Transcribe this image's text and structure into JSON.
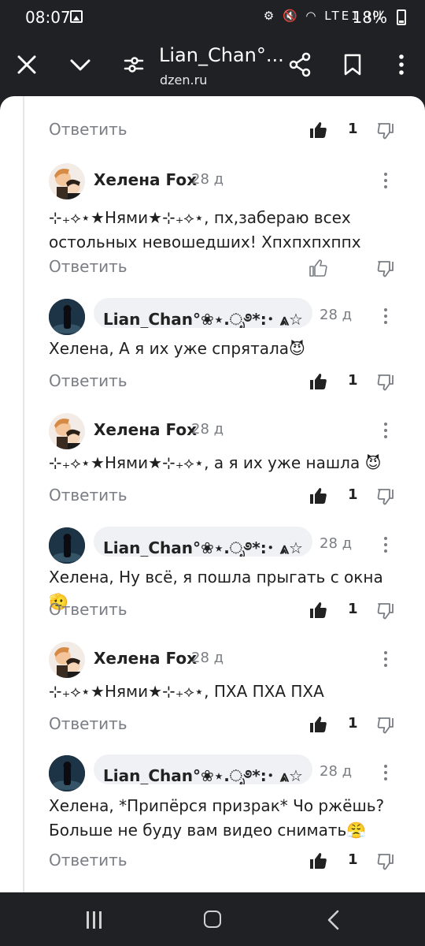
{
  "status_bar": {
    "time": "08:07",
    "icons": "⚙ 🔇 ◠ LTE1 ıll",
    "battery": "18%"
  },
  "app_bar": {
    "title": "Lian_Chan°...",
    "url": "dzen.ru"
  },
  "top_row": {
    "reply_label": "Ответить",
    "likes": "1"
  },
  "comments": [
    {
      "author": "Хелена Fox",
      "date": "28 д",
      "text": "⊹₊⟡⋆★Нями★⊹₊⟡⋆, пх,забераю всех остольных невошедших! Хпхпхпхппх",
      "reply_label": "Ответить",
      "likes": ""
    },
    {
      "author": "Lian_Chan°❀⋆.ೃ࿔*:･ ⩓☆ 🪐 ...",
      "date": "28 д",
      "text": "Хелена, А я их уже спрятала😈",
      "reply_label": "Ответить",
      "likes": "1"
    },
    {
      "author": "Хелена Fox",
      "date": "28 д",
      "text": "⊹₊⟡⋆★Нями★⊹₊⟡⋆, а я их уже нашла 😈",
      "reply_label": "Ответить",
      "likes": "1"
    },
    {
      "author": "Lian_Chan°❀⋆.ೃ࿔*:･ ⩓☆ 🪐 ...",
      "date": "28 д",
      "text": "Хелена, Ну всё, я пошла прыгать с окна🫡",
      "reply_label": "Ответить",
      "likes": "1"
    },
    {
      "author": "Хелена Fox",
      "date": "28 д",
      "text": "⊹₊⟡⋆★Нями★⊹₊⟡⋆, ПХА ПХА ПХА",
      "reply_label": "Ответить",
      "likes": "1"
    },
    {
      "author": "Lian_Chan°❀⋆.ೃ࿔*:･ ⩓☆ 🪐 ...",
      "date": "28 д",
      "text": "Хелена, *Припёрся призрак* Чо ржёшь? Больше не буду вам видео снимать😤",
      "reply_label": "Ответить",
      "likes": "1"
    }
  ],
  "icons": {
    "close": "close-icon",
    "collapse": "chevron-down-icon",
    "filter": "tune-icon",
    "share": "share-icon",
    "bookmark": "bookmark-icon",
    "more": "more-vert-icon",
    "like": "thumb-up-icon",
    "dislike": "thumb-down-icon"
  },
  "colors": {
    "bar_background": "#202124",
    "sheet_background": "#ffffff",
    "muted_text": "#7a7d83",
    "pill_background": "#f0f1f4"
  }
}
